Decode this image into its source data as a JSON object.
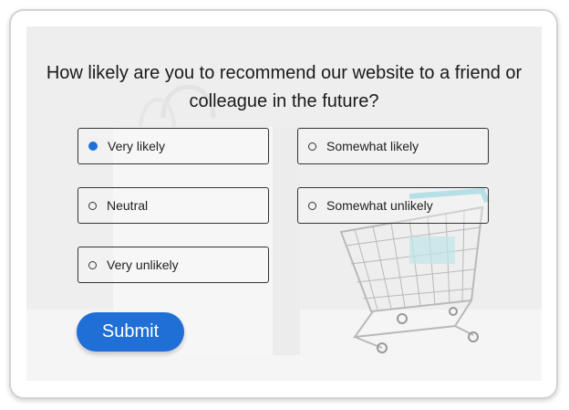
{
  "survey": {
    "question": "How likely are you to recommend our website to a friend or colleague in the future?",
    "options": [
      {
        "label": "Very likely",
        "selected": true
      },
      {
        "label": "Somewhat likely",
        "selected": false
      },
      {
        "label": "Neutral",
        "selected": false
      },
      {
        "label": "Somewhat unlikely",
        "selected": false
      },
      {
        "label": "Very unlikely",
        "selected": false
      }
    ],
    "submit_label": "Submit"
  },
  "colors": {
    "accent": "#1f6fd6",
    "panel_background": "#eeeeee",
    "cart_handle": "#8fd3dc"
  },
  "background_image": {
    "icons": [
      "shopping-bag-icon",
      "shopping-cart-icon"
    ]
  }
}
